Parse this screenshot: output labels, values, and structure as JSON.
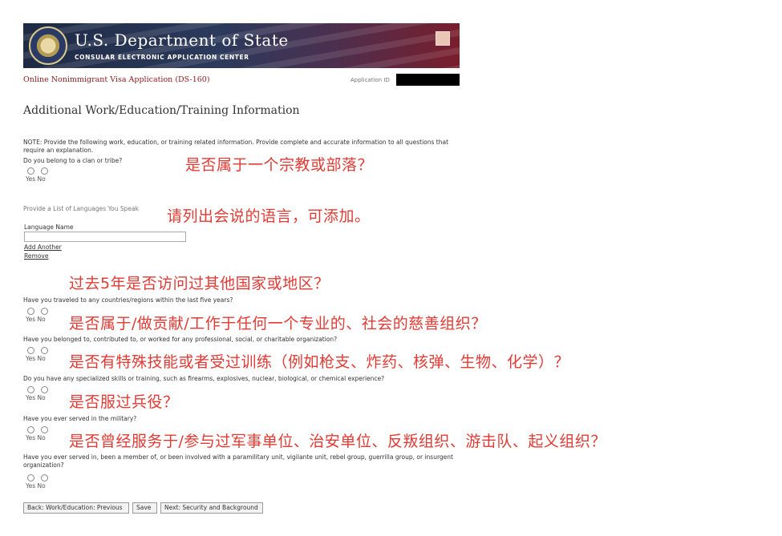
{
  "banner": {
    "title": "U.S. Department of State",
    "subtitle": "CONSULAR ELECTRONIC APPLICATION CENTER"
  },
  "app": {
    "title": "Online Nonimmigrant Visa Application (DS-160)",
    "id_label": "Application ID",
    "id_value": ""
  },
  "page_title": "Additional Work/Education/Training Information",
  "note": "NOTE: Provide the following work, education, or training related information. Provide complete and accurate information to all questions that require an explanation.",
  "radio_labels": "Yes No",
  "questions": {
    "clan": "Do you belong to a clan or tribe?",
    "languages": "Provide a List of Languages You Speak",
    "language_name": "Language Name",
    "add_another": "Add Another",
    "remove": "Remove",
    "travel": "Have you traveled to any countries/regions within the last five years?",
    "orgs": "Have you belonged to, contributed to, or worked for any professional, social, or charitable organization?",
    "skills": "Do you have any specialized skills or training, such as firearms, explosives, nuclear, biological, or chemical experience?",
    "military": "Have you ever served in the military?",
    "paramilitary": "Have you ever served in, been a member of, or been involved with a paramilitary unit, vigilante unit, rebel group, guerrilla group, or insurgent organization?"
  },
  "annotations": {
    "clan": "是否属于一个宗教或部落？",
    "languages": "请列出会说的语言，可添加。",
    "travel": "过去5年是否访问过其他国家或地区？",
    "orgs": "是否属于/做贡献/工作于任何一个专业的、社会的慈善组织？",
    "skills": "是否有特殊技能或者受过训练（例如枪支、炸药、核弹、生物、化学）？",
    "military": "是否服过兵役？",
    "paramilitary": "是否曾经服务于/参与过军事单位、治安单位、反叛组织、游击队、起义组织？"
  },
  "buttons": {
    "back": "Back: Work/Education: Previous",
    "save": "Save",
    "next": "Next: Security and Background"
  },
  "colors": {
    "annotation": "#e23a34",
    "app_title": "#8b1a1a"
  }
}
